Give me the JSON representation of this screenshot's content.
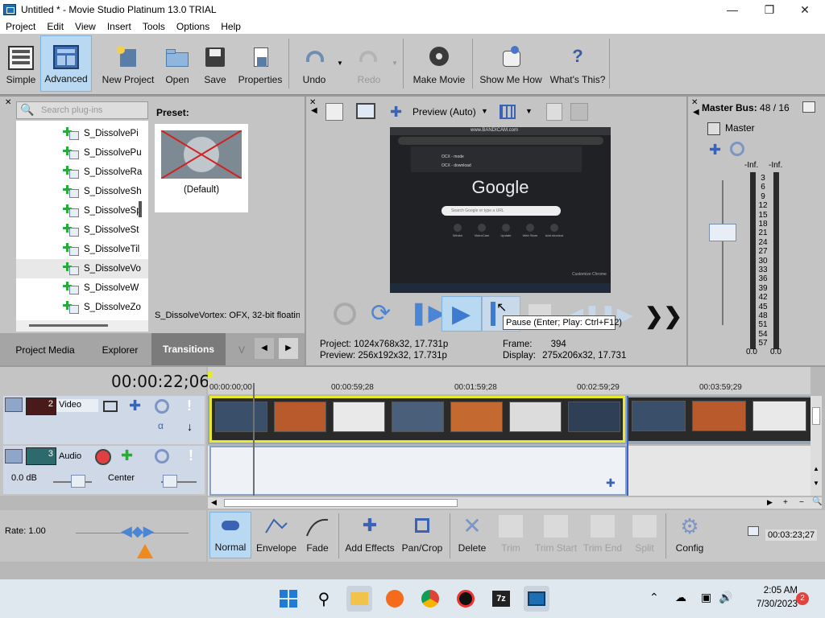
{
  "window": {
    "title": "Untitled * - Movie Studio Platinum 13.0 TRIAL"
  },
  "menu": [
    "Project",
    "Edit",
    "View",
    "Insert",
    "Tools",
    "Options",
    "Help"
  ],
  "toolbar": {
    "simple": "Simple",
    "advanced": "Advanced",
    "new_project": "New Project",
    "open": "Open",
    "save": "Save",
    "properties": "Properties",
    "undo": "Undo",
    "redo": "Redo",
    "make_movie": "Make Movie",
    "show_me_how": "Show Me How",
    "whats_this": "What's This?"
  },
  "plugins": {
    "search_placeholder": "Search plug-ins",
    "items": [
      "S_DissolvePi",
      "S_DissolvePu",
      "S_DissolveRa",
      "S_DissolveSh",
      "S_DissolveSp",
      "S_DissolveSt",
      "S_DissolveTil",
      "S_DissolveVo",
      "S_DissolveW",
      "S_DissolveZo"
    ],
    "selected_index": 7,
    "preset_label": "Preset:",
    "preset_name": "(Default)",
    "status": "S_DissolveVortex: OFX, 32-bit floatin"
  },
  "tabs": [
    "Project Media",
    "Explorer",
    "Transitions",
    "V"
  ],
  "preview": {
    "mode": "Preview (Auto)",
    "tooltip": "Pause (Enter; Play: Ctrl+F12)",
    "project_label": "Project:",
    "project_value": "1024x768x32, 17.731p",
    "preview_label": "Preview:",
    "preview_value": "256x192x32, 17.731p",
    "frame_label": "Frame:",
    "frame_value": "394",
    "display_label": "Display:",
    "display_value": "275x206x32, 17.731",
    "screen_url_bar": "www.BANDICAM.com",
    "screen_logo": "Google",
    "screen_search": "Search Google or type a URL",
    "screen_sub1": "OCX - mode",
    "screen_sub2": "OCX - download",
    "screen_shortcuts": [
      "WinAvi",
      "VideoCam",
      "Update",
      "Web Store",
      "Add shortcut"
    ],
    "screen_customize": "Customize Chrome"
  },
  "master": {
    "title": "Master Bus:",
    "value": "48 / 16",
    "label": "Master",
    "peak_left": "-Inf.",
    "peak_right": "-Inf.",
    "scale": [
      "3",
      "6",
      "9",
      "12",
      "15",
      "18",
      "21",
      "24",
      "27",
      "30",
      "33",
      "36",
      "39",
      "42",
      "45",
      "48",
      "51",
      "54",
      "57"
    ],
    "bottom_left": "0.0",
    "bottom_right": "0.0"
  },
  "timeline": {
    "time": "00:00:22;06",
    "ruler": [
      "00:00:00;00",
      "00:00:59;28",
      "00:01:59;28",
      "00:02:59;29",
      "00:03:59;29"
    ],
    "video_track": {
      "number": "2",
      "name": "Video"
    },
    "audio_track": {
      "number": "3",
      "name": "Audio",
      "volume": "0.0 dB",
      "pan": "Center"
    },
    "rate_label": "Rate: 1.00",
    "end_time": "00:03:23;27"
  },
  "bottom_toolbar": [
    "Normal",
    "Envelope",
    "Fade",
    "Add Effects",
    "Pan/Crop",
    "Delete",
    "Trim",
    "Trim Start",
    "Trim End",
    "Split",
    "Config"
  ],
  "taskbar": {
    "time": "2:05 AM",
    "date": "7/30/2023",
    "badge": "2"
  },
  "colors": {
    "selection": "#b9d8f2",
    "clip_border": "#e7ea2a",
    "accent": "#1c6fb5",
    "playhead": "#3a63c9"
  }
}
